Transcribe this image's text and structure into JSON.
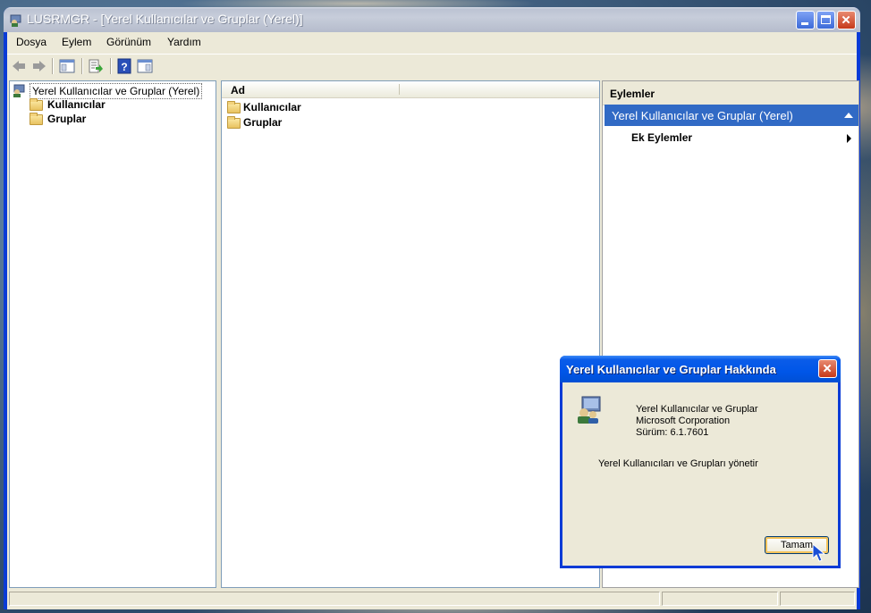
{
  "window": {
    "title": "LUSRMGR - [Yerel Kullanıcılar ve Gruplar (Yerel)]"
  },
  "menubar": {
    "items": [
      "Dosya",
      "Eylem",
      "Görünüm",
      "Yardım"
    ]
  },
  "toolbar": {
    "icons": [
      "back-icon",
      "forward-icon",
      "show-hide-tree-icon",
      "export-list-icon",
      "help-icon",
      "properties-view-icon"
    ]
  },
  "tree": {
    "root": "Yerel Kullanıcılar ve Gruplar (Yerel)",
    "children": [
      "Kullanıcılar",
      "Gruplar"
    ]
  },
  "list": {
    "column_header": "Ad",
    "items": [
      "Kullanıcılar",
      "Gruplar"
    ]
  },
  "actions": {
    "header": "Eylemler",
    "section": "Yerel Kullanıcılar ve Gruplar (Yerel)",
    "item": "Ek Eylemler"
  },
  "dialog": {
    "title": "Yerel Kullanıcılar ve Gruplar Hakkında",
    "product": "Yerel Kullanıcılar ve Gruplar",
    "company": "Microsoft Corporation",
    "version": "Sürüm: 6.1.7601",
    "description": "Yerel Kullanıcıları ve Grupları yönetir",
    "ok_button": "Tamam"
  },
  "colors": {
    "title_active": "#0054e3",
    "selection": "#316ac5",
    "window_bg": "#ece9d8"
  }
}
